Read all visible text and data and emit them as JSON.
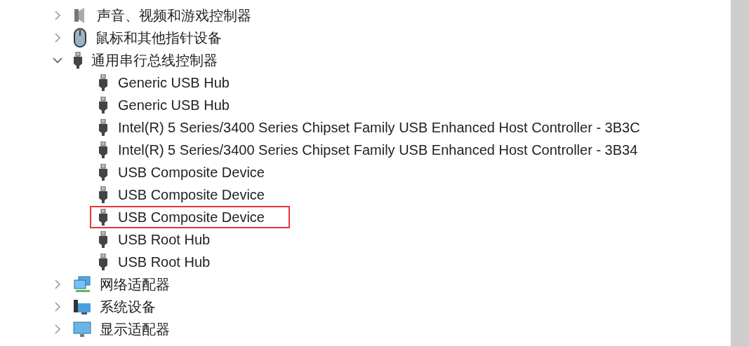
{
  "device_tree": [
    {
      "label": "声音、视频和游戏控制器",
      "expanded": false
    },
    {
      "label": "鼠标和其他指针设备",
      "expanded": false
    },
    {
      "label": "通用串行总线控制器",
      "expanded": true,
      "children": [
        {
          "label": "Generic USB Hub",
          "highlighted": false
        },
        {
          "label": "Generic USB Hub",
          "highlighted": false
        },
        {
          "label": "Intel(R) 5 Series/3400 Series Chipset Family USB Enhanced Host Controller - 3B3C",
          "highlighted": false
        },
        {
          "label": "Intel(R) 5 Series/3400 Series Chipset Family USB Enhanced Host Controller - 3B34",
          "highlighted": false
        },
        {
          "label": "USB Composite Device",
          "highlighted": false
        },
        {
          "label": "USB Composite Device",
          "highlighted": false
        },
        {
          "label": "USB Composite Device",
          "highlighted": true
        },
        {
          "label": "USB Root Hub",
          "highlighted": false
        },
        {
          "label": "USB Root Hub",
          "highlighted": false
        }
      ]
    },
    {
      "label": "网络适配器",
      "expanded": false
    },
    {
      "label": "系统设备",
      "expanded": false
    },
    {
      "label": "显示适配器",
      "expanded": false
    }
  ]
}
